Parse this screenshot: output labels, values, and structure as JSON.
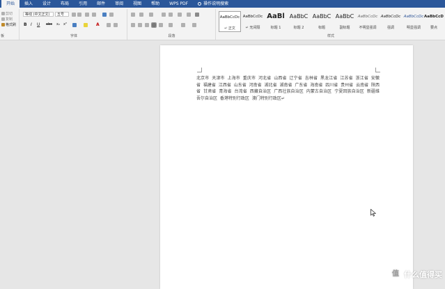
{
  "tabs": [
    "开始",
    "插入",
    "设计",
    "布局",
    "引用",
    "邮件",
    "审阅",
    "视图",
    "帮助",
    "WPS PDF"
  ],
  "tell_me": "操作说明搜索",
  "clipboard": {
    "cut": "剪切",
    "copy": "复制",
    "painter": "格式刷",
    "label": "板"
  },
  "font": {
    "font_name": "等线 (中文正文)",
    "font_size": "五号",
    "group_label": "字体",
    "bold": "B",
    "italic": "I",
    "underline": "U",
    "strike": "abc",
    "sub": "x₂",
    "sup": "x²",
    "font_color": "A"
  },
  "paragraph": {
    "group_label": "段落"
  },
  "styles": {
    "group_label": "样式",
    "items": [
      {
        "sample": "AaBbCcDc",
        "name": "↵ 正文"
      },
      {
        "sample": "AaBbCcDc",
        "name": "↵ 无间隔"
      },
      {
        "sample": "AaBl",
        "name": "标题 1"
      },
      {
        "sample": "AaBbC",
        "name": "标题 2"
      },
      {
        "sample": "AaBbC",
        "name": "标题"
      },
      {
        "sample": "AaBbC",
        "name": "副标题"
      },
      {
        "sample": "AaBbCcDc",
        "name": "不明显强调"
      },
      {
        "sample": "AaBbCcDc",
        "name": "强调"
      },
      {
        "sample": "AaBbCcDc",
        "name": "明显强调"
      },
      {
        "sample": "AaBbCcDc",
        "name": "要点"
      }
    ]
  },
  "document": {
    "text": "北京市 天津市 上海市 重庆市 河北省 山西省 辽宁省 吉林省 黑龙江省 江苏省 浙江省 安徽省 福建省 江西省 山东省 河南省 湖北省 湖南省 广东省 海南省 四川省 贵州省 云南省 陕西省 甘肃省 青海省 台湾省 西藏自治区 广西壮族自治区 内蒙古自治区 宁夏回族自治区 新疆维吾尔自治区 香港特别行政区 澳门特别行政区↵"
  },
  "watermark": {
    "logo": "值",
    "text": "什么值得买"
  }
}
